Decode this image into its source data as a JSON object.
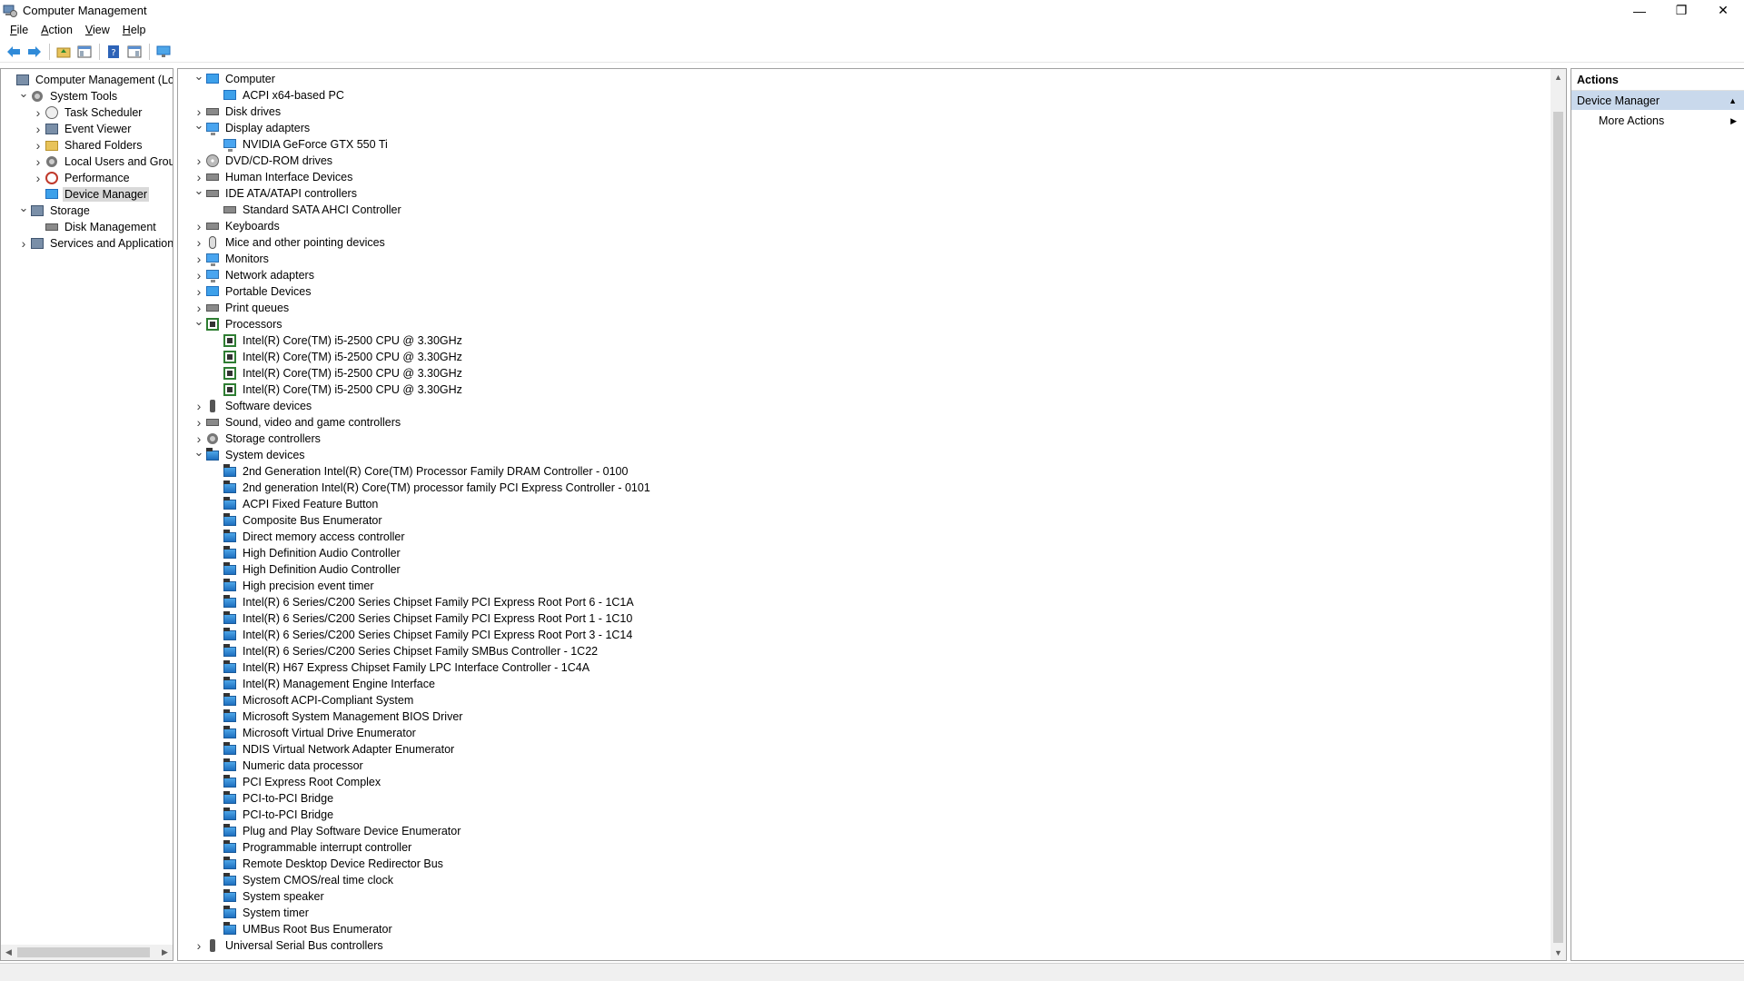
{
  "window": {
    "title": "Computer Management",
    "controls": {
      "minimize": "—",
      "restore": "❐",
      "close": "✕"
    }
  },
  "menu": [
    {
      "label_ul": "F",
      "label_rest": "ile"
    },
    {
      "label_ul": "A",
      "label_rest": "ction"
    },
    {
      "label_ul": "V",
      "label_rest": "iew"
    },
    {
      "label_ul": "H",
      "label_rest": "elp"
    }
  ],
  "toolbar": {
    "icons": [
      "back-icon",
      "forward-icon",
      "up-folder-icon",
      "show-hide-console-tree-icon",
      "help-icon",
      "properties-icon",
      "monitor-icon"
    ]
  },
  "left_tree": [
    {
      "label": "Computer Management (Local",
      "depth": 0,
      "expander": "",
      "icon": "mgmt"
    },
    {
      "label": "System Tools",
      "depth": 1,
      "expander": "v",
      "icon": "gear"
    },
    {
      "label": "Task Scheduler",
      "depth": 2,
      "expander": ">",
      "icon": "clock"
    },
    {
      "label": "Event Viewer",
      "depth": 2,
      "expander": ">",
      "icon": "mgmt"
    },
    {
      "label": "Shared Folders",
      "depth": 2,
      "expander": ">",
      "icon": "folder"
    },
    {
      "label": "Local Users and Groups",
      "depth": 2,
      "expander": ">",
      "icon": "gear"
    },
    {
      "label": "Performance",
      "depth": 2,
      "expander": ">",
      "icon": "no"
    },
    {
      "label": "Device Manager",
      "depth": 2,
      "expander": "",
      "icon": "comp",
      "selected": true
    },
    {
      "label": "Storage",
      "depth": 1,
      "expander": "v",
      "icon": "mgmt"
    },
    {
      "label": "Disk Management",
      "depth": 2,
      "expander": "",
      "icon": "gray"
    },
    {
      "label": "Services and Applications",
      "depth": 1,
      "expander": ">",
      "icon": "mgmt"
    }
  ],
  "device_tree": [
    {
      "label": "Computer",
      "depth": 0,
      "expander": "v",
      "icon": "comp"
    },
    {
      "label": "ACPI x64-based PC",
      "depth": 1,
      "expander": "",
      "icon": "comp"
    },
    {
      "label": "Disk drives",
      "depth": 0,
      "expander": ">",
      "icon": "gray"
    },
    {
      "label": "Display adapters",
      "depth": 0,
      "expander": "v",
      "icon": "mon"
    },
    {
      "label": "NVIDIA GeForce GTX 550 Ti",
      "depth": 1,
      "expander": "",
      "icon": "mon"
    },
    {
      "label": "DVD/CD-ROM drives",
      "depth": 0,
      "expander": ">",
      "icon": "disc"
    },
    {
      "label": "Human Interface Devices",
      "depth": 0,
      "expander": ">",
      "icon": "gray"
    },
    {
      "label": "IDE ATA/ATAPI controllers",
      "depth": 0,
      "expander": "v",
      "icon": "gray"
    },
    {
      "label": "Standard SATA AHCI Controller",
      "depth": 1,
      "expander": "",
      "icon": "gray"
    },
    {
      "label": "Keyboards",
      "depth": 0,
      "expander": ">",
      "icon": "gray"
    },
    {
      "label": "Mice and other pointing devices",
      "depth": 0,
      "expander": ">",
      "icon": "mouse"
    },
    {
      "label": "Monitors",
      "depth": 0,
      "expander": ">",
      "icon": "mon"
    },
    {
      "label": "Network adapters",
      "depth": 0,
      "expander": ">",
      "icon": "mon"
    },
    {
      "label": "Portable Devices",
      "depth": 0,
      "expander": ">",
      "icon": "comp"
    },
    {
      "label": "Print queues",
      "depth": 0,
      "expander": ">",
      "icon": "gray"
    },
    {
      "label": "Processors",
      "depth": 0,
      "expander": "v",
      "icon": "cpu"
    },
    {
      "label": "Intel(R) Core(TM) i5-2500 CPU @ 3.30GHz",
      "depth": 1,
      "expander": "",
      "icon": "cpu"
    },
    {
      "label": "Intel(R) Core(TM) i5-2500 CPU @ 3.30GHz",
      "depth": 1,
      "expander": "",
      "icon": "cpu"
    },
    {
      "label": "Intel(R) Core(TM) i5-2500 CPU @ 3.30GHz",
      "depth": 1,
      "expander": "",
      "icon": "cpu"
    },
    {
      "label": "Intel(R) Core(TM) i5-2500 CPU @ 3.30GHz",
      "depth": 1,
      "expander": "",
      "icon": "cpu"
    },
    {
      "label": "Software devices",
      "depth": 0,
      "expander": ">",
      "icon": "usb"
    },
    {
      "label": "Sound, video and game controllers",
      "depth": 0,
      "expander": ">",
      "icon": "gray"
    },
    {
      "label": "Storage controllers",
      "depth": 0,
      "expander": ">",
      "icon": "gear"
    },
    {
      "label": "System devices",
      "depth": 0,
      "expander": "v",
      "icon": "dev"
    },
    {
      "label": "2nd Generation Intel(R) Core(TM) Processor Family DRAM Controller - 0100",
      "depth": 1,
      "expander": "",
      "icon": "dev"
    },
    {
      "label": "2nd generation Intel(R) Core(TM) processor family PCI Express Controller - 0101",
      "depth": 1,
      "expander": "",
      "icon": "dev"
    },
    {
      "label": "ACPI Fixed Feature Button",
      "depth": 1,
      "expander": "",
      "icon": "dev"
    },
    {
      "label": "Composite Bus Enumerator",
      "depth": 1,
      "expander": "",
      "icon": "dev"
    },
    {
      "label": "Direct memory access controller",
      "depth": 1,
      "expander": "",
      "icon": "dev"
    },
    {
      "label": "High Definition Audio Controller",
      "depth": 1,
      "expander": "",
      "icon": "dev"
    },
    {
      "label": "High Definition Audio Controller",
      "depth": 1,
      "expander": "",
      "icon": "dev"
    },
    {
      "label": "High precision event timer",
      "depth": 1,
      "expander": "",
      "icon": "dev"
    },
    {
      "label": "Intel(R) 6 Series/C200 Series Chipset Family PCI Express Root Port 6 - 1C1A",
      "depth": 1,
      "expander": "",
      "icon": "dev"
    },
    {
      "label": "Intel(R) 6 Series/C200 Series Chipset Family PCI Express Root Port 1 - 1C10",
      "depth": 1,
      "expander": "",
      "icon": "dev"
    },
    {
      "label": "Intel(R) 6 Series/C200 Series Chipset Family PCI Express Root Port 3 - 1C14",
      "depth": 1,
      "expander": "",
      "icon": "dev"
    },
    {
      "label": "Intel(R) 6 Series/C200 Series Chipset Family SMBus Controller - 1C22",
      "depth": 1,
      "expander": "",
      "icon": "dev"
    },
    {
      "label": "Intel(R) H67 Express Chipset Family LPC Interface Controller - 1C4A",
      "depth": 1,
      "expander": "",
      "icon": "dev"
    },
    {
      "label": "Intel(R) Management Engine Interface",
      "depth": 1,
      "expander": "",
      "icon": "dev"
    },
    {
      "label": "Microsoft ACPI-Compliant System",
      "depth": 1,
      "expander": "",
      "icon": "dev"
    },
    {
      "label": "Microsoft System Management BIOS Driver",
      "depth": 1,
      "expander": "",
      "icon": "dev"
    },
    {
      "label": "Microsoft Virtual Drive Enumerator",
      "depth": 1,
      "expander": "",
      "icon": "dev"
    },
    {
      "label": "NDIS Virtual Network Adapter Enumerator",
      "depth": 1,
      "expander": "",
      "icon": "dev"
    },
    {
      "label": "Numeric data processor",
      "depth": 1,
      "expander": "",
      "icon": "dev"
    },
    {
      "label": "PCI Express Root Complex",
      "depth": 1,
      "expander": "",
      "icon": "dev"
    },
    {
      "label": "PCI-to-PCI Bridge",
      "depth": 1,
      "expander": "",
      "icon": "dev"
    },
    {
      "label": "PCI-to-PCI Bridge",
      "depth": 1,
      "expander": "",
      "icon": "dev"
    },
    {
      "label": "Plug and Play Software Device Enumerator",
      "depth": 1,
      "expander": "",
      "icon": "dev"
    },
    {
      "label": "Programmable interrupt controller",
      "depth": 1,
      "expander": "",
      "icon": "dev"
    },
    {
      "label": "Remote Desktop Device Redirector Bus",
      "depth": 1,
      "expander": "",
      "icon": "dev"
    },
    {
      "label": "System CMOS/real time clock",
      "depth": 1,
      "expander": "",
      "icon": "dev"
    },
    {
      "label": "System speaker",
      "depth": 1,
      "expander": "",
      "icon": "dev"
    },
    {
      "label": "System timer",
      "depth": 1,
      "expander": "",
      "icon": "dev"
    },
    {
      "label": "UMBus Root Bus Enumerator",
      "depth": 1,
      "expander": "",
      "icon": "dev"
    },
    {
      "label": "Universal Serial Bus controllers",
      "depth": 0,
      "expander": ">",
      "icon": "usb"
    }
  ],
  "actions": {
    "header": "Actions",
    "section": "Device Manager",
    "items": [
      "More Actions"
    ]
  }
}
